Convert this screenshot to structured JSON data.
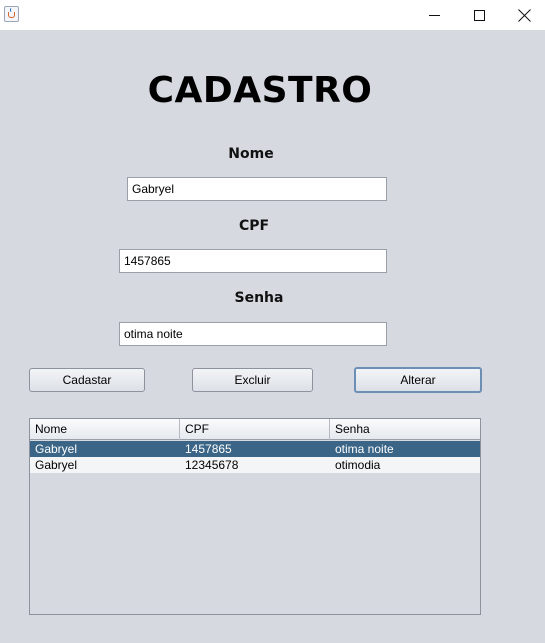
{
  "window": {
    "icon": "java-cup-icon",
    "controls": [
      "minimize-icon",
      "maximize-icon",
      "close-icon"
    ]
  },
  "form": {
    "title": "CADASTRO",
    "nome_label": "Nome",
    "nome_value": "Gabryel",
    "cpf_label": "CPF",
    "cpf_value": "1457865",
    "senha_label": "Senha",
    "senha_value": "otima noite"
  },
  "buttons": {
    "cadastrar": "Cadastar",
    "excluir": "Excluir",
    "alterar": "Alterar"
  },
  "table": {
    "columns": [
      "Nome",
      "CPF",
      "Senha"
    ],
    "rows": [
      {
        "nome": "Gabryel",
        "cpf": "1457865",
        "senha": "otima noite",
        "selected": true
      },
      {
        "nome": "Gabryel",
        "cpf": "12345678",
        "senha": "otimodia",
        "selected": false
      }
    ]
  },
  "colors": {
    "background": "#d6d9e0",
    "selection": "#3a6586"
  }
}
